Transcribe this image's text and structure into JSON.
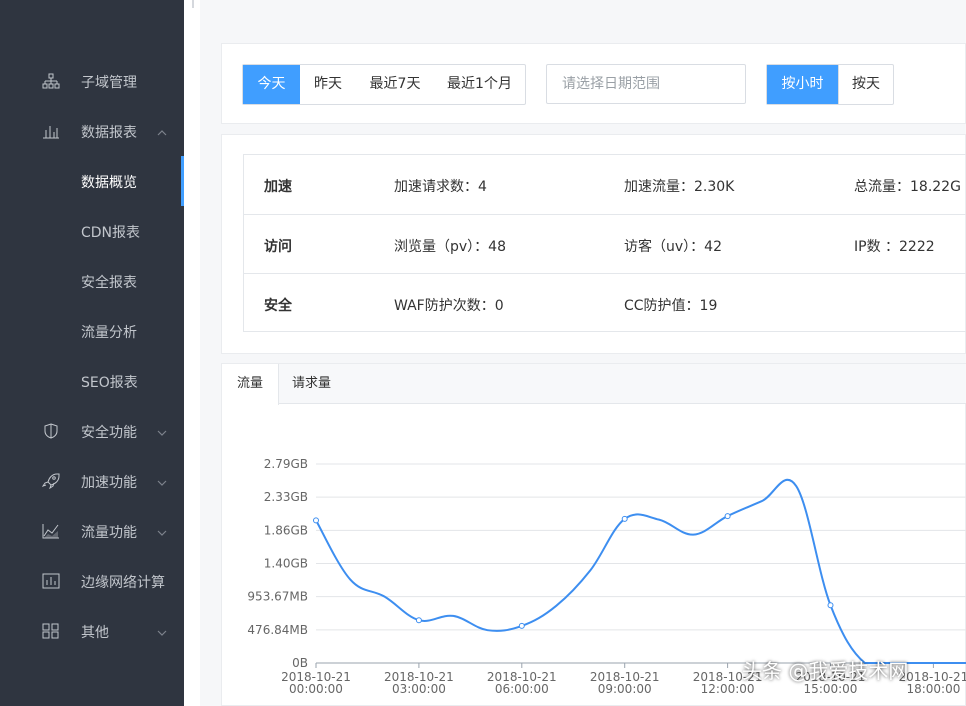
{
  "sidebar": {
    "items": [
      {
        "label": "子域管理",
        "icon": "sitemap-icon",
        "chevron": "none"
      },
      {
        "label": "数据报表",
        "icon": "bar-chart-icon",
        "chevron": "up"
      },
      {
        "label": "数据概览",
        "icon": "",
        "chevron": "none",
        "sub": true,
        "active": true
      },
      {
        "label": "CDN报表",
        "icon": "",
        "chevron": "none",
        "sub": true
      },
      {
        "label": "安全报表",
        "icon": "",
        "chevron": "none",
        "sub": true
      },
      {
        "label": "流量分析",
        "icon": "",
        "chevron": "none",
        "sub": true
      },
      {
        "label": "SEO报表",
        "icon": "",
        "chevron": "none",
        "sub": true
      },
      {
        "label": "安全功能",
        "icon": "shield-icon",
        "chevron": "down"
      },
      {
        "label": "加速功能",
        "icon": "rocket-icon",
        "chevron": "down"
      },
      {
        "label": "流量功能",
        "icon": "area-chart-icon",
        "chevron": "down"
      },
      {
        "label": "边缘网络计算",
        "icon": "column-chart-icon",
        "chevron": "none"
      },
      {
        "label": "其他",
        "icon": "grid-icon",
        "chevron": "down"
      }
    ]
  },
  "filter": {
    "range_buttons": [
      "今天",
      "昨天",
      "最近7天",
      "最近1个月"
    ],
    "active_range": "今天",
    "date_placeholder": "请选择日期范围",
    "granularity_buttons": [
      "按小时",
      "按天"
    ],
    "active_granularity": "按小时"
  },
  "stats": {
    "rows": [
      {
        "category": "加速",
        "cells": [
          "加速请求数：4",
          "加速流量：2.30K",
          "总流量：18.22G"
        ]
      },
      {
        "category": "访问",
        "cells": [
          "浏览量（pv）：48",
          "访客（uv）：42",
          "IP数 ：2222"
        ]
      },
      {
        "category": "安全",
        "cells": [
          "WAF防护次数：0",
          "CC防护值：19",
          ""
        ]
      }
    ]
  },
  "chart": {
    "tabs": [
      "流量",
      "请求量"
    ],
    "active_tab": "流量"
  },
  "chart_data": {
    "type": "line",
    "title": "",
    "xlabel": "",
    "ylabel": "",
    "y_ticks": [
      "0B",
      "476.84MB",
      "953.67MB",
      "1.40GB",
      "1.86GB",
      "2.33GB",
      "2.79GB"
    ],
    "ylim_gb": [
      0,
      2.79
    ],
    "x_ticks": [
      {
        "date": "2018-10-21",
        "time": "00:00:00"
      },
      {
        "date": "2018-10-21",
        "time": "03:00:00"
      },
      {
        "date": "2018-10-21",
        "time": "06:00:00"
      },
      {
        "date": "2018-10-21",
        "time": "09:00:00"
      },
      {
        "date": "2018-10-21",
        "time": "12:00:00"
      },
      {
        "date": "2018-10-21",
        "time": "15:00:00"
      },
      {
        "date": "2018-10-21",
        "time": "18:00:00"
      }
    ],
    "series": [
      {
        "color": "#3d8ef0",
        "hours": [
          0,
          1,
          2,
          3,
          4,
          5,
          6,
          7,
          8,
          9,
          10,
          11,
          12,
          13,
          14,
          15,
          16,
          17,
          18,
          19
        ],
        "values_gb": [
          2.0,
          1.17,
          0.93,
          0.6,
          0.66,
          0.46,
          0.52,
          0.8,
          1.3,
          2.02,
          2.01,
          1.8,
          2.06,
          2.27,
          2.48,
          0.81,
          0.0,
          0.0,
          0.0,
          0.0
        ],
        "markers": [
          0,
          3,
          6,
          9,
          12,
          15
        ]
      }
    ]
  },
  "watermark": "头条 @我爱技术网"
}
